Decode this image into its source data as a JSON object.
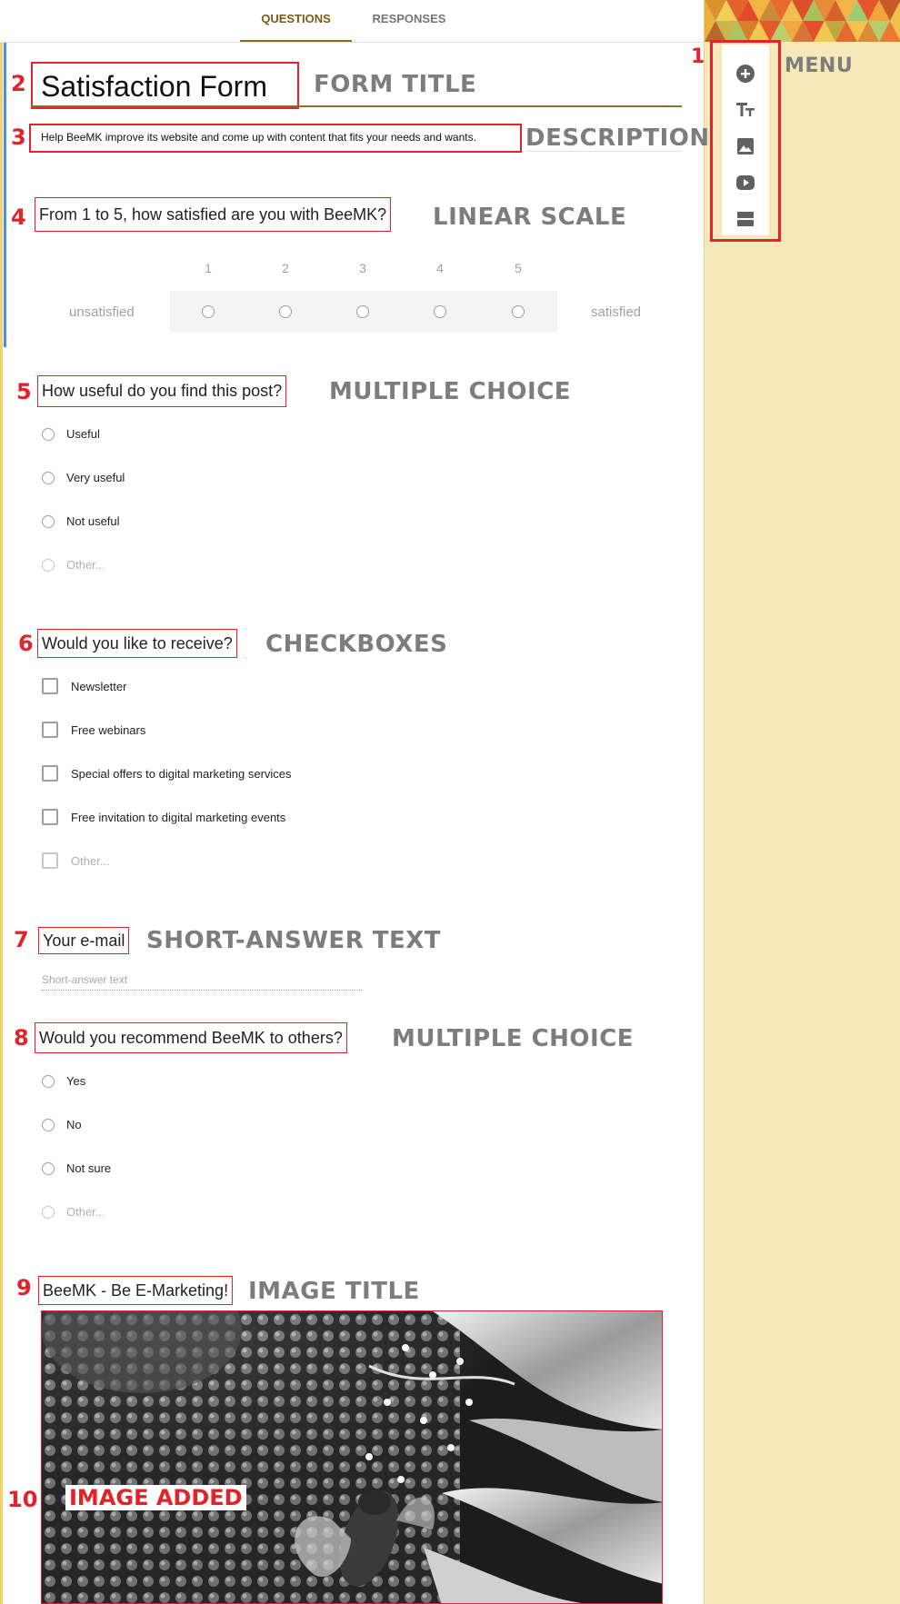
{
  "tabs": {
    "questions": "QUESTIONS",
    "responses": "RESPONSES"
  },
  "menu": {
    "number": "1",
    "label": "MENU",
    "icons": [
      "add-question-icon",
      "add-title-icon",
      "add-image-icon",
      "add-video-icon",
      "add-section-icon"
    ]
  },
  "form_title": {
    "number": "2",
    "value": "Satisfaction Form",
    "label": "FORM TITLE"
  },
  "description": {
    "number": "3",
    "value": "Help BeeMK improve its website and come up with content that fits your needs and wants.",
    "label": "DESCRIPTION"
  },
  "q_linear": {
    "number": "4",
    "question": "From 1 to 5, how satisfied are you with BeeMK?",
    "label": "LINEAR SCALE",
    "scale": [
      "1",
      "2",
      "3",
      "4",
      "5"
    ],
    "low_label": "unsatisfied",
    "high_label": "satisfied"
  },
  "q_useful": {
    "number": "5",
    "question": "How useful do you find this post?",
    "label": "MULTIPLE CHOICE",
    "options": [
      "Useful",
      "Very useful",
      "Not useful",
      "Other..."
    ]
  },
  "q_receive": {
    "number": "6",
    "question": "Would you like to receive?",
    "label": "CHECKBOXES",
    "options": [
      "Newsletter",
      "Free webinars",
      "Special offers to digital marketing services",
      "Free invitation to digital marketing events",
      "Other..."
    ]
  },
  "q_email": {
    "number": "7",
    "question": "Your e-mail",
    "label": "SHORT-ANSWER TEXT",
    "placeholder": "Short-answer text"
  },
  "q_recommend": {
    "number": "8",
    "question": "Would you recommend BeeMK to others?",
    "label": "MULTIPLE CHOICE",
    "options": [
      "Yes",
      "No",
      "Not sure",
      "Other..."
    ]
  },
  "image_block": {
    "number": "9",
    "title": "BeeMK - Be E-Marketing!",
    "label": "IMAGE TITLE",
    "image_number": "10",
    "image_label": "IMAGE ADDED"
  },
  "colors": {
    "annotation_red": "#e2232a",
    "panel_bg": "#f6e8b9",
    "tab_active": "#795a14",
    "accent_blue": "#4a8de2"
  }
}
